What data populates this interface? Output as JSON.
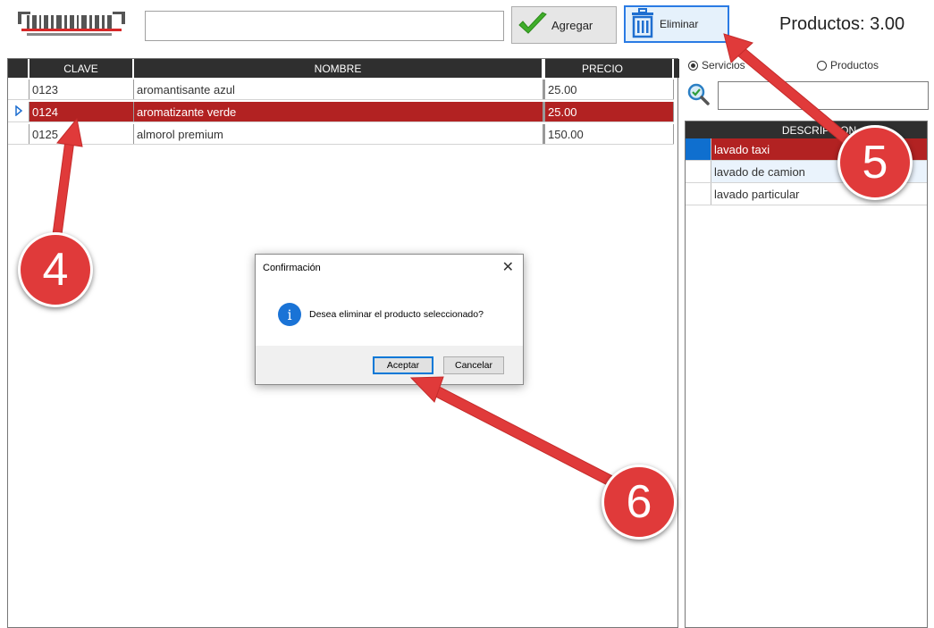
{
  "toolbar": {
    "barcode_icon": "barcode-scanner-icon",
    "code_input_value": "",
    "add_label": "Agregar",
    "add_icon": "checkmark-icon",
    "delete_label": "Eliminar",
    "delete_icon": "trash-icon",
    "count_label": "Productos: 3.00"
  },
  "main_grid": {
    "columns": [
      "CLAVE",
      "NOMBRE",
      "PRECIO"
    ],
    "rows": [
      {
        "clave": "0123",
        "nombre": "aromantisante azul",
        "precio": "25.00",
        "selected": false
      },
      {
        "clave": "0124",
        "nombre": "aromatizante verde",
        "precio": "25.00",
        "selected": true
      },
      {
        "clave": "0125",
        "nombre": "almorol premium",
        "precio": "150.00",
        "selected": false
      }
    ]
  },
  "filter": {
    "options": [
      {
        "label": "Servicios",
        "checked": true
      },
      {
        "label": "Productos",
        "checked": false
      }
    ],
    "search_value": ""
  },
  "side_grid": {
    "header": "DESCRIPCION",
    "rows": [
      {
        "label": "lavado taxi",
        "selected": true
      },
      {
        "label": "lavado de camion",
        "selected": false
      },
      {
        "label": "lavado particular",
        "selected": false
      }
    ]
  },
  "dialog": {
    "title": "Confirmación",
    "message": "Desea eliminar el producto seleccionado?",
    "ok_label": "Aceptar",
    "cancel_label": "Cancelar",
    "icon": "info-icon"
  },
  "annotations": [
    "4",
    "5",
    "6"
  ],
  "colors": {
    "selected_row": "#b22222",
    "header_bg": "#2f2f2f",
    "annotation": "#e03a3a",
    "accent_blue": "#0078d7"
  }
}
